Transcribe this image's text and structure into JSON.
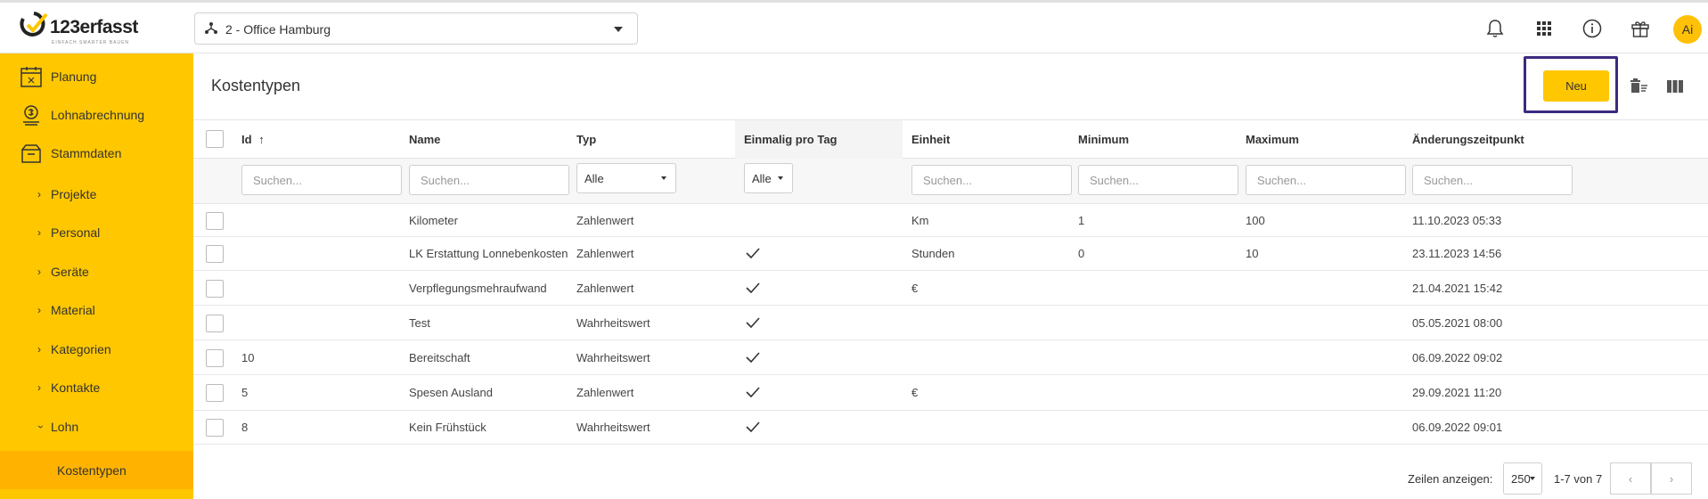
{
  "brand": {
    "name": "123erfasst",
    "tagline": "EINFACH SMARTER BAUEN"
  },
  "header": {
    "company": "2 - Office Hamburg",
    "avatar_initials": "Ai",
    "icons": [
      "bell-icon",
      "apps-grid-icon",
      "info-icon",
      "gift-icon"
    ]
  },
  "sidebar": {
    "items": [
      {
        "label": "Planung",
        "icon": "calendar-icon"
      },
      {
        "label": "Lohnabrechnung",
        "icon": "money-icon"
      },
      {
        "label": "Stammdaten",
        "icon": "box-icon"
      },
      {
        "label": "Projekte"
      },
      {
        "label": "Personal"
      },
      {
        "label": "Geräte"
      },
      {
        "label": "Material"
      },
      {
        "label": "Kategorien"
      },
      {
        "label": "Kontakte"
      },
      {
        "label": "Lohn"
      },
      {
        "label": "Kostentypen"
      }
    ]
  },
  "page": {
    "title": "Kostentypen",
    "new_button": "Neu"
  },
  "table": {
    "columns": [
      "Id",
      "Name",
      "Typ",
      "Einmalig pro Tag",
      "Einheit",
      "Minimum",
      "Maximum",
      "Änderungszeitpunkt"
    ],
    "sort_indicator": "↑",
    "filters": {
      "search_placeholder": "Suchen...",
      "typ_value": "Alle",
      "einmalig_value": "Alle"
    },
    "rows": [
      {
        "id": "",
        "name": "Kilometer",
        "typ": "Zahlenwert",
        "einmalig": false,
        "einheit": "Km",
        "min": "1",
        "max": "100",
        "changed": "11.10.2023 05:33"
      },
      {
        "id": "",
        "name": "LK Erstattung Lonnebenkosten",
        "typ": "Zahlenwert",
        "einmalig": true,
        "einheit": "Stunden",
        "min": "0",
        "max": "10",
        "changed": "23.11.2023 14:56"
      },
      {
        "id": "",
        "name": "Verpflegungsmehraufwand",
        "typ": "Zahlenwert",
        "einmalig": true,
        "einheit": "€",
        "min": "",
        "max": "",
        "changed": "21.04.2021 15:42"
      },
      {
        "id": "",
        "name": "Test",
        "typ": "Wahrheitswert",
        "einmalig": true,
        "einheit": "",
        "min": "",
        "max": "",
        "changed": "05.05.2021 08:00"
      },
      {
        "id": "10",
        "name": "Bereitschaft",
        "typ": "Wahrheitswert",
        "einmalig": true,
        "einheit": "",
        "min": "",
        "max": "",
        "changed": "06.09.2022 09:02"
      },
      {
        "id": "5",
        "name": "Spesen Ausland",
        "typ": "Zahlenwert",
        "einmalig": true,
        "einheit": "€",
        "min": "",
        "max": "",
        "changed": "29.09.2021 11:20"
      },
      {
        "id": "8",
        "name": "Kein Frühstück",
        "typ": "Wahrheitswert",
        "einmalig": true,
        "einheit": "",
        "min": "",
        "max": "",
        "changed": "06.09.2022 09:01"
      }
    ]
  },
  "pagination": {
    "rows_label": "Zeilen anzeigen:",
    "page_size": "250",
    "range": "1-7 von 7",
    "prev": "‹",
    "next": "›"
  },
  "colors": {
    "accent": "#ffc700",
    "active_nav": "#ffb300",
    "highlight_border": "#3d2a80"
  }
}
